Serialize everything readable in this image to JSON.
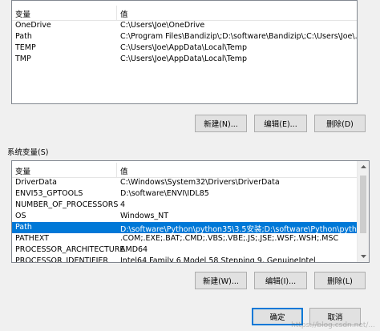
{
  "user_vars": {
    "header": {
      "name": "变量",
      "value": "值"
    },
    "rows": [
      {
        "name": "OneDrive",
        "value": "C:\\Users\\Joe\\OneDrive"
      },
      {
        "name": "Path",
        "value": "C:\\Program Files\\Bandizip\\;D:\\software\\Bandizip\\;C:\\Users\\Joe\\..."
      },
      {
        "name": "TEMP",
        "value": "C:\\Users\\Joe\\AppData\\Local\\Temp"
      },
      {
        "name": "TMP",
        "value": "C:\\Users\\Joe\\AppData\\Local\\Temp"
      }
    ],
    "buttons": {
      "new": "新建(N)...",
      "edit": "编辑(E)...",
      "delete": "删除(D)"
    }
  },
  "system_vars": {
    "group_label": "系统变量(S)",
    "header": {
      "name": "变量",
      "value": "值"
    },
    "rows": [
      {
        "name": "DriverData",
        "value": "C:\\Windows\\System32\\Drivers\\DriverData"
      },
      {
        "name": "ENVI53_GPTOOLS",
        "value": "D:\\software\\ENVI\\IDL85"
      },
      {
        "name": "NUMBER_OF_PROCESSORS",
        "value": "4"
      },
      {
        "name": "OS",
        "value": "Windows_NT"
      },
      {
        "name": "Path",
        "value": "D:\\software\\Python\\python35\\3.5安装;D:\\software\\Python\\pyth..."
      },
      {
        "name": "PATHEXT",
        "value": ".COM;.EXE;.BAT;.CMD;.VBS;.VBE;.JS;.JSE;.WSF;.WSH;.MSC"
      },
      {
        "name": "PROCESSOR_ARCHITECTURE",
        "value": "AMD64"
      },
      {
        "name": "PROCESSOR_IDENTIFIER",
        "value": "Intel64 Family 6 Model 58 Stepping 9, GenuineIntel"
      }
    ],
    "selected_index": 4,
    "buttons": {
      "new": "新建(W)...",
      "edit": "编辑(I)...",
      "delete": "删除(L)"
    }
  },
  "dialog_buttons": {
    "ok": "确定",
    "cancel": "取消"
  },
  "watermark": "https://blog.csdn.net/...",
  "colors": {
    "selection": "#0078d7",
    "ok_border": "#0078d7"
  }
}
